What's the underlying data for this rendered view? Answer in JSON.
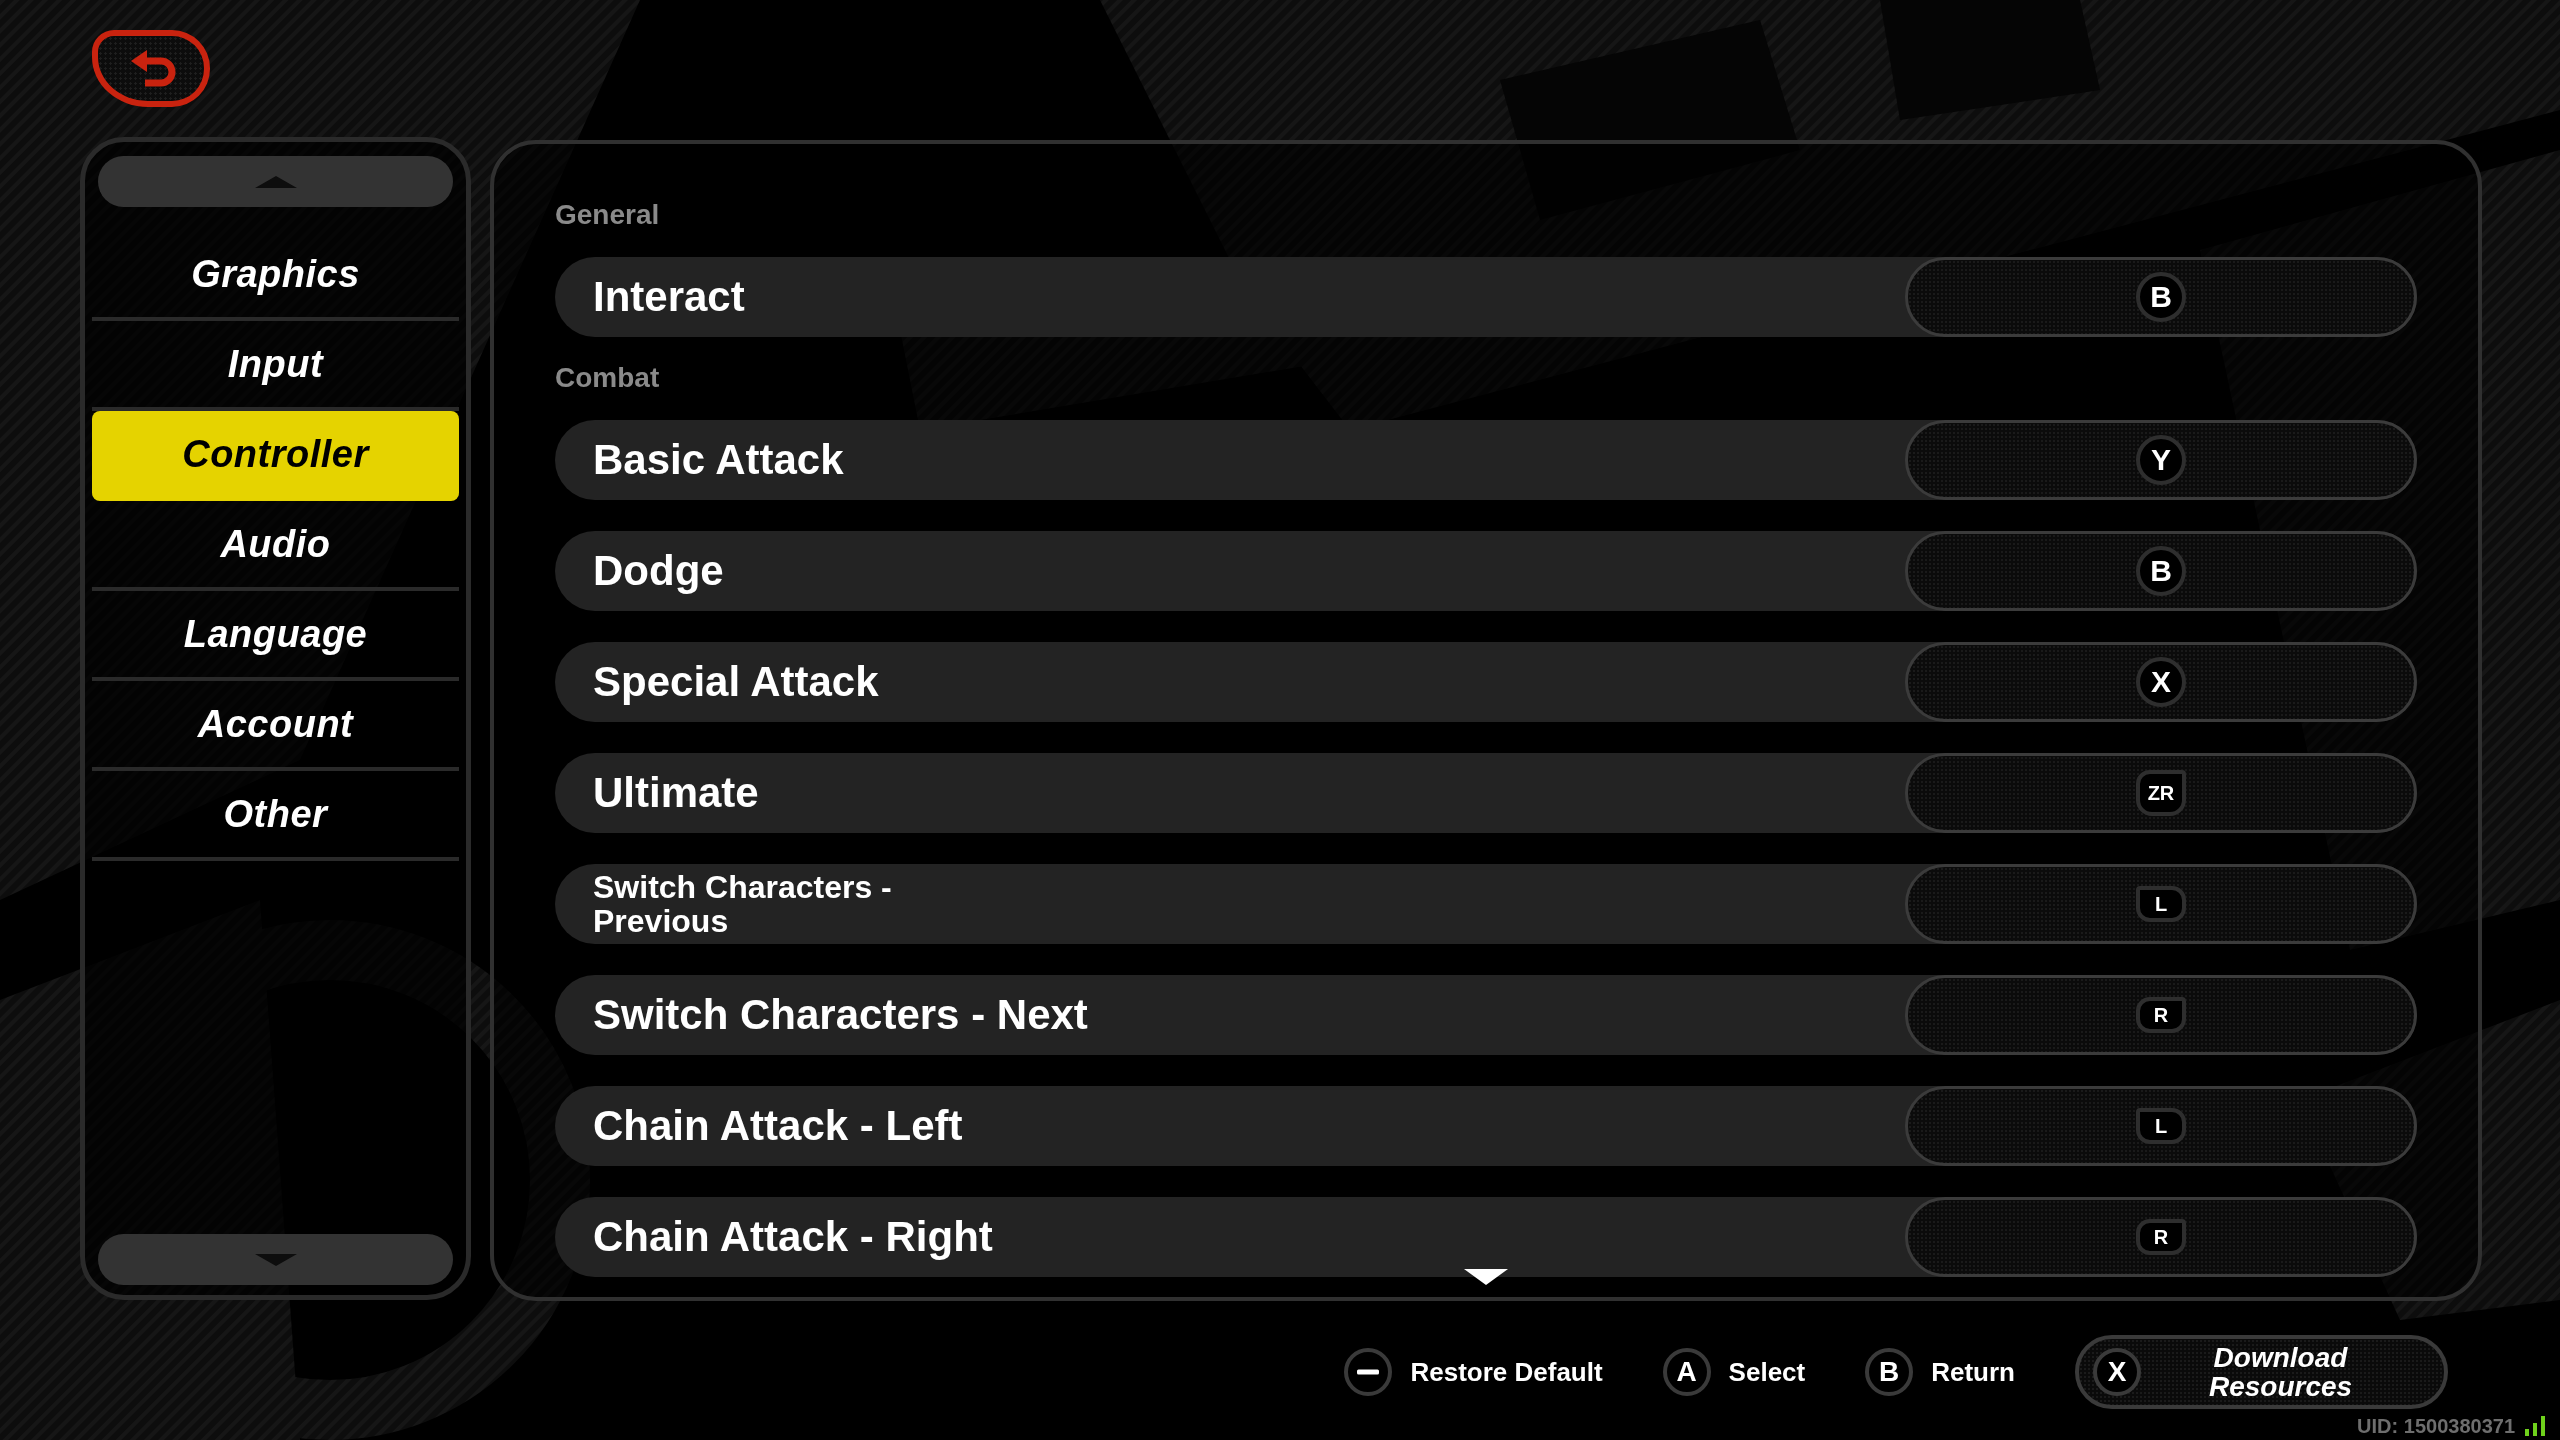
{
  "sidebar": {
    "items": [
      {
        "label": "Graphics",
        "selected": false
      },
      {
        "label": "Input",
        "selected": false
      },
      {
        "label": "Controller",
        "selected": true
      },
      {
        "label": "Audio",
        "selected": false
      },
      {
        "label": "Language",
        "selected": false
      },
      {
        "label": "Account",
        "selected": false
      },
      {
        "label": "Other",
        "selected": false
      }
    ]
  },
  "sections": [
    {
      "heading": "General",
      "rows": [
        {
          "action": "Interact",
          "binding": {
            "kind": "face",
            "key": "B"
          }
        }
      ]
    },
    {
      "heading": "Combat",
      "rows": [
        {
          "action": "Basic Attack",
          "binding": {
            "kind": "face",
            "key": "Y"
          }
        },
        {
          "action": "Dodge",
          "binding": {
            "kind": "face",
            "key": "B"
          }
        },
        {
          "action": "Special Attack",
          "binding": {
            "kind": "face",
            "key": "X"
          }
        },
        {
          "action": "Ultimate",
          "binding": {
            "kind": "trigger_right",
            "key": "ZR"
          }
        },
        {
          "action": "Switch Characters - Previous",
          "binding": {
            "kind": "shoulder_left",
            "key": "L"
          }
        },
        {
          "action": "Switch Characters - Next",
          "binding": {
            "kind": "shoulder_right",
            "key": "R"
          }
        },
        {
          "action": "Chain Attack - Left",
          "binding": {
            "kind": "shoulder_left",
            "key": "L"
          }
        },
        {
          "action": "Chain Attack - Right",
          "binding": {
            "kind": "shoulder_right",
            "key": "R"
          }
        }
      ]
    }
  ],
  "footer": {
    "hints": [
      {
        "kind": "minus",
        "label": "Restore Default"
      },
      {
        "kind": "face",
        "key": "A",
        "label": "Select"
      },
      {
        "kind": "face",
        "key": "B",
        "label": "Return"
      }
    ],
    "download_button": {
      "kind": "face",
      "key": "X",
      "label": "Download Resources"
    }
  },
  "uid": "UID: 1500380371"
}
